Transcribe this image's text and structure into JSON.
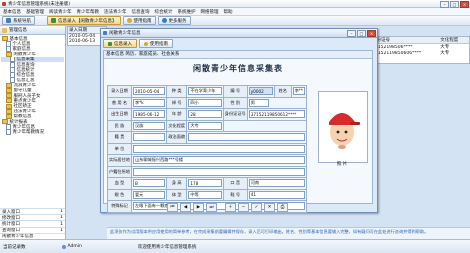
{
  "app": {
    "title": "青少年信息管理系统(未注册版)"
  },
  "menu": [
    "基本信息",
    "基础管理",
    "阅读青少年",
    "青少年帮教",
    "违法青少年",
    "信息查询",
    "综合统计",
    "系统维护",
    "网络管理",
    "帮助"
  ],
  "toolbar": {
    "system_nav": "系统导航",
    "tabs": [
      "信息录入【闲散青少年信息】",
      "使用指南",
      "更多服务"
    ]
  },
  "sidebar": {
    "header": "管理信息",
    "items": [
      {
        "label": "基本信息",
        "level": 0,
        "kind": "folder"
      },
      {
        "label": "个人信息",
        "level": 1,
        "kind": "doc"
      },
      {
        "label": "家庭信息",
        "level": 1,
        "kind": "doc"
      },
      {
        "label": "闲散青少年",
        "level": 1,
        "kind": "folder"
      },
      {
        "label": "信息采集",
        "level": 2,
        "kind": "doc"
      },
      {
        "label": "信息查询",
        "level": 2,
        "kind": "doc"
      },
      {
        "label": "信息统计",
        "level": 2,
        "kind": "doc"
      },
      {
        "label": "综合信息",
        "level": 2,
        "kind": "doc"
      },
      {
        "label": "信息汇总",
        "level": 2,
        "kind": "doc"
      },
      {
        "label": "流浪青少年",
        "level": 1,
        "kind": "folder"
      },
      {
        "label": "留守儿童",
        "level": 1,
        "kind": "folder"
      },
      {
        "label": "服刑人员子女",
        "level": 1,
        "kind": "folder"
      },
      {
        "label": "重点青少年",
        "level": 1,
        "kind": "folder"
      },
      {
        "label": "社区矫正",
        "level": 1,
        "kind": "folder"
      },
      {
        "label": "违法青少年",
        "level": 1,
        "kind": "folder"
      },
      {
        "label": "帮教信息",
        "level": 1,
        "kind": "folder"
      },
      {
        "label": "统计报表",
        "level": 0,
        "kind": "folder"
      },
      {
        "label": "青少年信息",
        "level": 1,
        "kind": "doc"
      },
      {
        "label": "青少年帮教情况",
        "level": 1,
        "kind": "doc"
      }
    ],
    "footer": [
      {
        "label": "录入窗口",
        "count": "1"
      },
      {
        "label": "修改窗口",
        "count": "1"
      },
      {
        "label": "统计窗口",
        "count": "1"
      },
      {
        "label": "查询窗口",
        "count": "1"
      },
      {
        "label": "闲散青少年信息",
        "count": ""
      }
    ]
  },
  "list_panel": {
    "header": "录入日期",
    "rows": [
      "2010-05-04",
      "2010-06-13"
    ]
  },
  "right_table": {
    "headers": [
      "身份证号",
      "文化程度"
    ],
    "rows": [
      [
        "37152198506****",
        "大专"
      ],
      [
        "37152119850606****",
        "大专"
      ]
    ]
  },
  "dialog": {
    "title": "闲散青少年信息",
    "tabs": [
      "信息录入",
      "使用指南"
    ],
    "section_tabs": "基本信息   简历、家庭成员、社会关系",
    "form_title": "闲散青少年信息采集表",
    "fields": {
      "entry_date_label": "录入日期",
      "entry_date": "2010-05-04",
      "category_label": "种  类",
      "category": "不在学青少年",
      "number_label": "编  号",
      "number": "y0002",
      "name_label": "姓名",
      "name": "李**",
      "used_name_label": "曾 用 名",
      "used_name": "李*k",
      "nickname_label": "绰  号",
      "nickname": "四小",
      "gender_label": "性  别",
      "gender": "男",
      "birth_label": "出生日期",
      "birth": "1985-06-12",
      "age_label": "年  龄",
      "age": "28",
      "id_label": "身份证证号",
      "id": "37152119850612****",
      "ethnic_label": "民  族",
      "ethnic": "汉族",
      "edu_label": "文化程度",
      "edu": "大专",
      "native_label": "籍  贯",
      "native": "",
      "political_label": "政治面貌",
      "political": "",
      "employer_label": "单  位",
      "employer": "",
      "reg_addr_label": "实际居住地",
      "reg_addr": "山东聊城振兴西路***号楼",
      "hukou_label": "户籍住所地",
      "hukou": "",
      "blood_label": "血  型",
      "blood": "B",
      "height_label": "身  高",
      "height": "178",
      "phone_label": "口  音",
      "phone": "河南",
      "weight_label": "体  重",
      "weight": "63",
      "eye_label": "眼  色",
      "eye": "爱元",
      "body_label": "体  型",
      "body": "中等",
      "shoe_label": "鞋  号",
      "shoe": "41",
      "feature_label": "特殊标记",
      "feature": "左眼下面有一颗痣"
    },
    "photo_label": "照  片"
  },
  "note": "此项仅作为试用版本供应用使用的简单参考，在完成采集前要编辑并保存，录入后可打印输出。姓名、性别等基本信息要输入完整，如有疑问可在此处进行咨询并得到帮助。",
  "status": {
    "left": "当前记录数",
    "user": "Admin",
    "right": "欢迎使用青少年信息管理系统"
  }
}
